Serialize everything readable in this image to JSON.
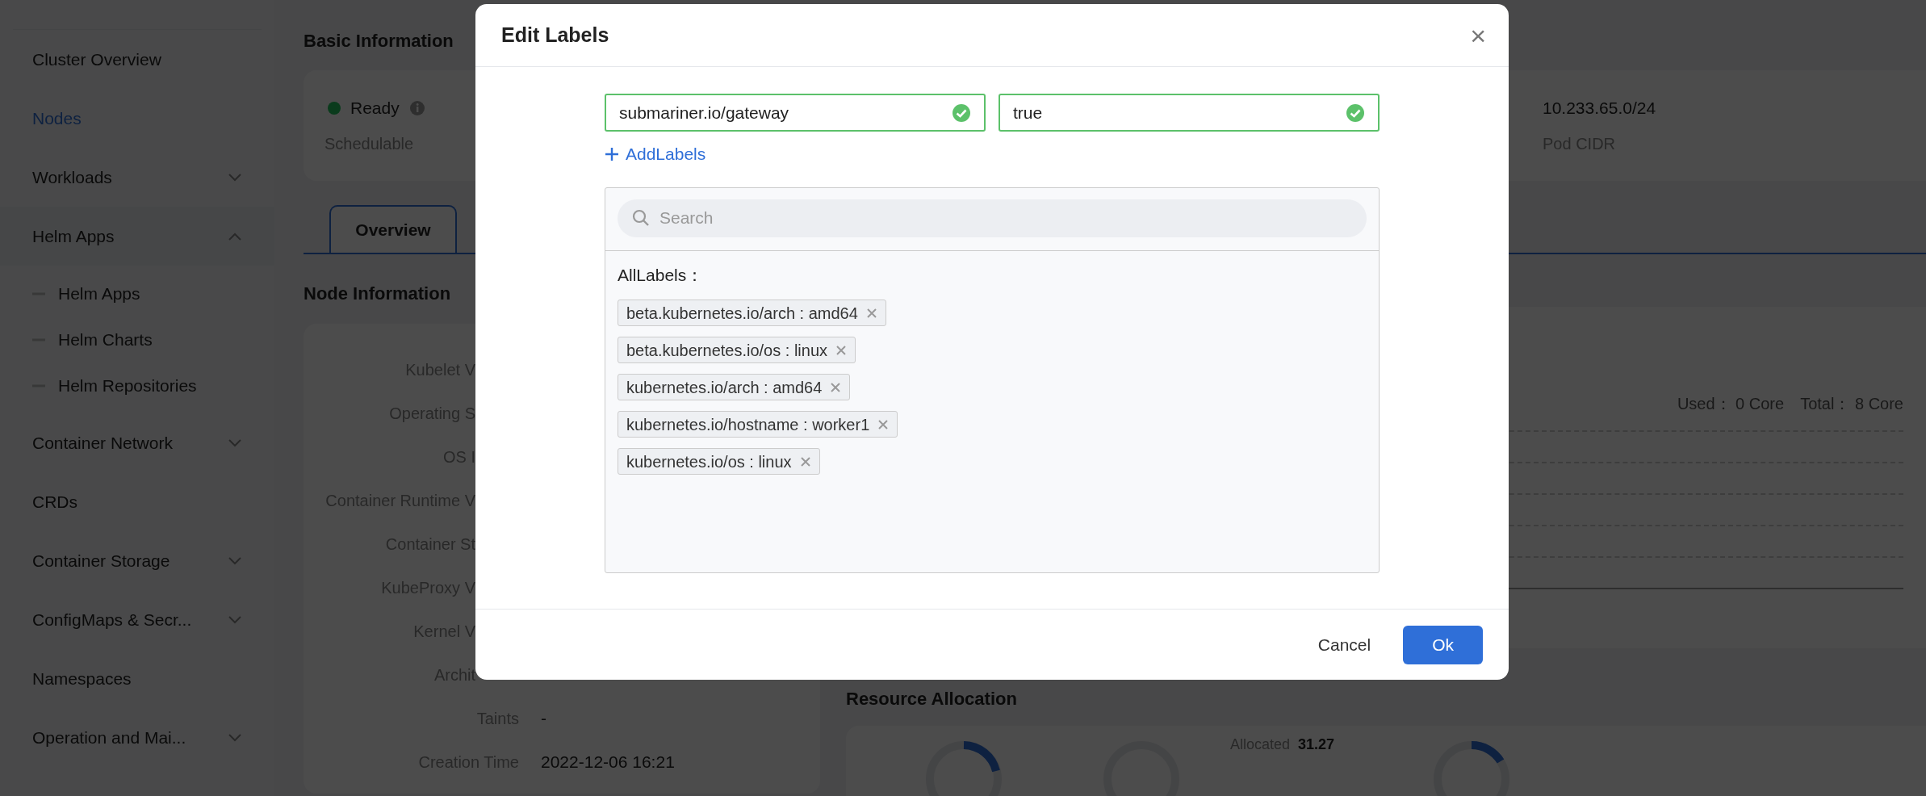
{
  "sidebar": {
    "items": [
      {
        "label": "Cluster Overview",
        "selected": false
      },
      {
        "label": "Nodes",
        "selected": true
      },
      {
        "label": "Workloads",
        "selected": false,
        "expanded": false
      },
      {
        "label": "Helm Apps",
        "selected": false,
        "expanded": true,
        "children": [
          {
            "label": "Helm Apps",
            "selected": false
          },
          {
            "label": "Helm Charts",
            "selected": false
          },
          {
            "label": "Helm Repositories",
            "selected": false
          }
        ]
      },
      {
        "label": "Container Network",
        "selected": false,
        "expanded": false
      },
      {
        "label": "CRDs",
        "selected": false
      },
      {
        "label": "Container Storage",
        "selected": false,
        "expanded": false
      },
      {
        "label": "ConfigMaps & Secr...",
        "selected": false,
        "expanded": false
      },
      {
        "label": "Namespaces",
        "selected": false
      },
      {
        "label": "Operation and Mai...",
        "selected": false,
        "expanded": false
      }
    ]
  },
  "basic_information": {
    "title": "Basic Information",
    "status": "Ready",
    "status_sub": "Schedulable",
    "pod_cidr": "10.233.65.0/24",
    "pod_cidr_label": "Pod CIDR"
  },
  "tabs": [
    {
      "label": "Overview",
      "selected": true
    }
  ],
  "node_information": {
    "title": "Node Information",
    "rows": [
      {
        "label": "Kubelet V"
      },
      {
        "label": "Operating S"
      },
      {
        "label": "OS I"
      },
      {
        "label": "Container Runtime V"
      },
      {
        "label": "Container St"
      },
      {
        "label": "KubeProxy V"
      },
      {
        "label": "Kernel V"
      },
      {
        "label": "Archit"
      },
      {
        "label": "Taints",
        "value": "-"
      },
      {
        "label": "Creation Time",
        "value": "2022-12-06 16:21"
      }
    ]
  },
  "cpu_panel": {
    "used_label": "Used：",
    "used": "0 Core",
    "total_label": "Total：",
    "total": "8 Core"
  },
  "resource_allocation": {
    "title": "Resource Allocation",
    "allocated_label": "Allocated",
    "allocated_value": "31.27"
  },
  "dialog": {
    "title": "Edit Labels",
    "close": "×",
    "key_value": "submariner.io/gateway",
    "value_value": "true",
    "add_label": "AddLabels",
    "search_placeholder": "Search",
    "all_labels_title": "AllLabels：",
    "labels": [
      "beta.kubernetes.io/arch : amd64",
      "beta.kubernetes.io/os : linux",
      "kubernetes.io/arch : amd64",
      "kubernetes.io/hostname : worker1",
      "kubernetes.io/os : linux"
    ],
    "buttons": [
      {
        "label": "Cancel",
        "kind": "text"
      },
      {
        "label": "Ok",
        "kind": "primary"
      }
    ]
  }
}
